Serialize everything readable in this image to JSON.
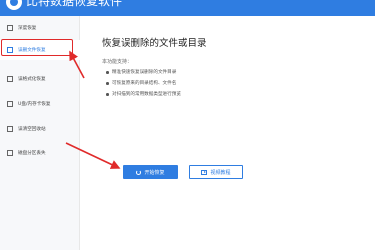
{
  "window": {
    "title": "比特数据恢复软件"
  },
  "sidebar": {
    "items": [
      {
        "label": "深度恢复",
        "icon": "clock-icon"
      },
      {
        "label": "误删文件恢复",
        "icon": "trash-icon"
      },
      {
        "label": "误格式化恢复",
        "icon": "disk-icon"
      },
      {
        "label": "U盘/内存卡恢复",
        "icon": "usb-icon"
      },
      {
        "label": "误清空回收站",
        "icon": "recycle-icon"
      },
      {
        "label": "磁盘分区丢失",
        "icon": "partition-icon"
      }
    ],
    "active_index": 1
  },
  "main": {
    "title": "恢复误删除的文件或目录",
    "intro_label": "本功能支持：",
    "features": [
      "精准快速恢复误删除的文件目录",
      "可恢复原来的目录结构、文件名",
      "对扫描到的常用数据类型进行预览"
    ],
    "start_button": "开始恢复",
    "video_button": "视频教程"
  },
  "colors": {
    "accent": "#2f7de1",
    "annotation": "#e02a2a"
  }
}
